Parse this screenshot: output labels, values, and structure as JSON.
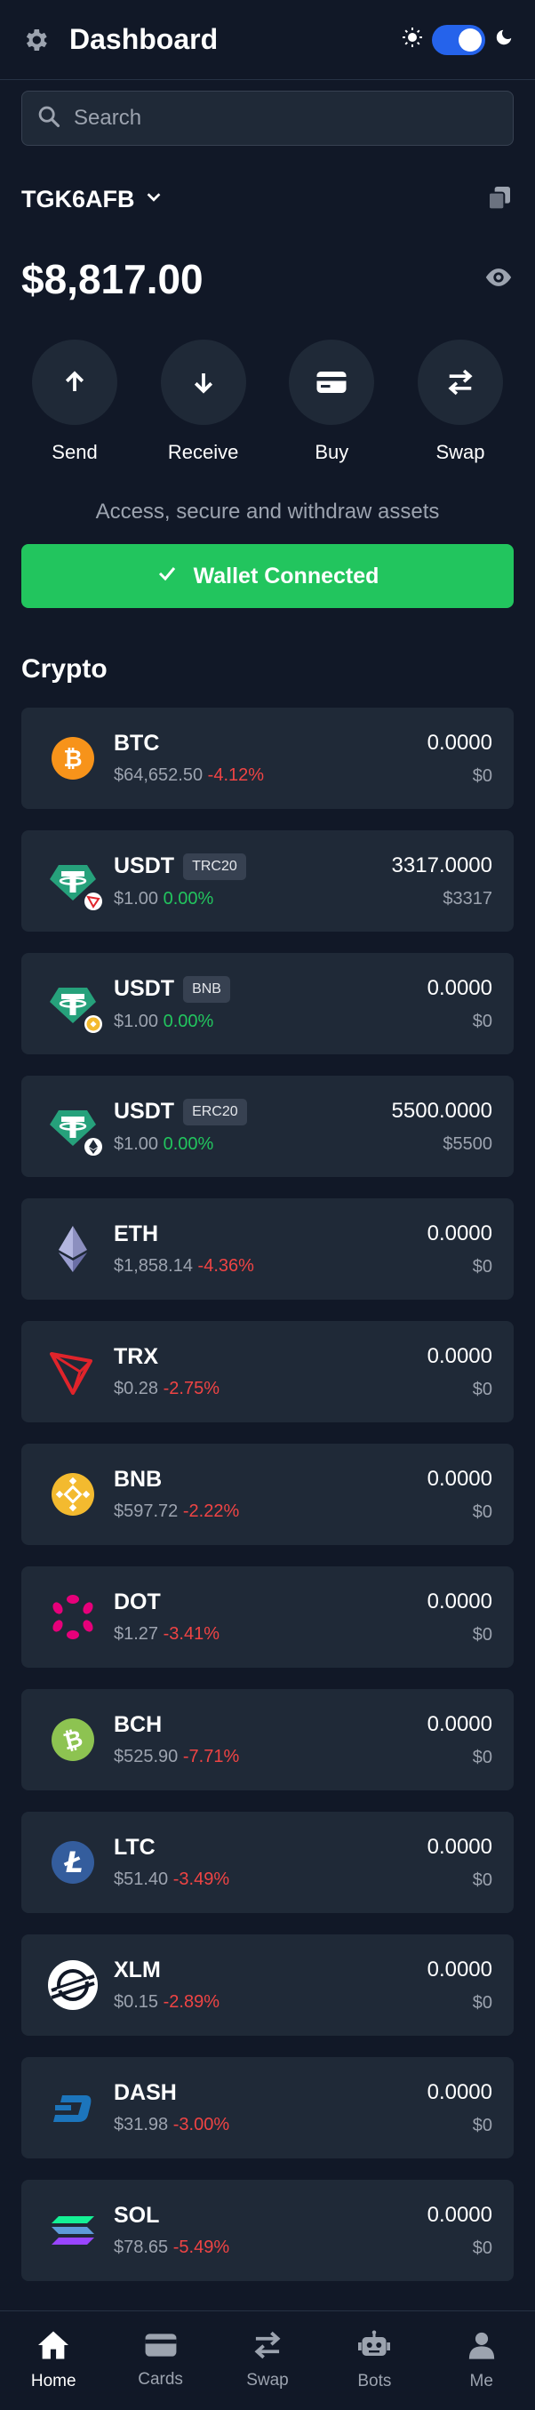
{
  "header": {
    "title": "Dashboard",
    "theme_dark": true
  },
  "search": {
    "placeholder": "Search"
  },
  "wallet": {
    "id": "TGK6AFB",
    "balance": "$8,817.00"
  },
  "actions": [
    {
      "label": "Send",
      "icon": "arrow-up-icon"
    },
    {
      "label": "Receive",
      "icon": "arrow-down-icon"
    },
    {
      "label": "Buy",
      "icon": "card-icon"
    },
    {
      "label": "Swap",
      "icon": "swap-icon"
    }
  ],
  "access_note": "Access, secure and withdraw assets",
  "connect_button": {
    "label": "Wallet Connected"
  },
  "crypto_section": {
    "title": "Crypto"
  },
  "assets": [
    {
      "symbol": "BTC",
      "badge": "",
      "price": "$64,652.50",
      "change": "-4.12%",
      "qty": "0.0000",
      "value": "$0"
    },
    {
      "symbol": "USDT",
      "badge": "TRC20",
      "price": "$1.00",
      "change": "0.00%",
      "qty": "3317.0000",
      "value": "$3317"
    },
    {
      "symbol": "USDT",
      "badge": "BNB",
      "price": "$1.00",
      "change": "0.00%",
      "qty": "0.0000",
      "value": "$0"
    },
    {
      "symbol": "USDT",
      "badge": "ERC20",
      "price": "$1.00",
      "change": "0.00%",
      "qty": "5500.0000",
      "value": "$5500"
    },
    {
      "symbol": "ETH",
      "badge": "",
      "price": "$1,858.14",
      "change": "-4.36%",
      "qty": "0.0000",
      "value": "$0"
    },
    {
      "symbol": "TRX",
      "badge": "",
      "price": "$0.28",
      "change": "-2.75%",
      "qty": "0.0000",
      "value": "$0"
    },
    {
      "symbol": "BNB",
      "badge": "",
      "price": "$597.72",
      "change": "-2.22%",
      "qty": "0.0000",
      "value": "$0"
    },
    {
      "symbol": "DOT",
      "badge": "",
      "price": "$1.27",
      "change": "-3.41%",
      "qty": "0.0000",
      "value": "$0"
    },
    {
      "symbol": "BCH",
      "badge": "",
      "price": "$525.90",
      "change": "-7.71%",
      "qty": "0.0000",
      "value": "$0"
    },
    {
      "symbol": "LTC",
      "badge": "",
      "price": "$51.40",
      "change": "-3.49%",
      "qty": "0.0000",
      "value": "$0"
    },
    {
      "symbol": "XLM",
      "badge": "",
      "price": "$0.15",
      "change": "-2.89%",
      "qty": "0.0000",
      "value": "$0"
    },
    {
      "symbol": "DASH",
      "badge": "",
      "price": "$31.98",
      "change": "-3.00%",
      "qty": "0.0000",
      "value": "$0"
    },
    {
      "symbol": "SOL",
      "badge": "",
      "price": "$78.65",
      "change": "-5.49%",
      "qty": "0.0000",
      "value": "$0"
    }
  ],
  "nav": [
    {
      "label": "Home",
      "active": true
    },
    {
      "label": "Cards",
      "active": false
    },
    {
      "label": "Swap",
      "active": false
    },
    {
      "label": "Bots",
      "active": false
    },
    {
      "label": "Me",
      "active": false
    }
  ],
  "colors": {
    "background": "#111827",
    "card": "#1f2937",
    "accent_green": "#22c55e",
    "negative": "#ef4444",
    "toggle": "#2563eb"
  }
}
